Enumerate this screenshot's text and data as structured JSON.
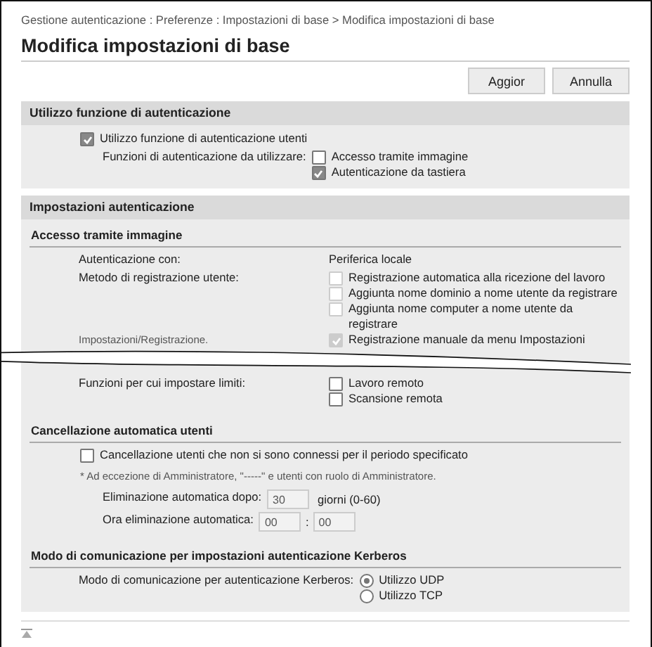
{
  "breadcrumb": "Gestione autenticazione : Preferenze : Impostazioni di base > Modifica impostazioni di base",
  "title": "Modifica impostazioni di base",
  "buttons": [
    {
      "label": "Aggior"
    },
    {
      "label": "Annulla"
    }
  ],
  "sections": [
    {
      "heading": "Utilizzo funzione di autenticazione",
      "subsections": [
        {
          "rows": [
            {
              "kind": "checkbox",
              "label": "Utilizzo funzione di autenticazione utenti",
              "checked": true,
              "disabled": false
            },
            {
              "kind": "options",
              "label": "Funzioni di autenticazione da utilizzare:",
              "options": [
                {
                  "label": "Accesso tramite immagine",
                  "checked": false,
                  "disabled": false
                },
                {
                  "label": "Autenticazione da tastiera",
                  "checked": true,
                  "disabled": false
                }
              ]
            }
          ]
        }
      ]
    },
    {
      "heading": "Impostazioni autenticazione",
      "subsections": [
        {
          "heading": "Accesso tramite immagine",
          "rows": [
            {
              "kind": "text",
              "label": "Autenticazione con:",
              "value": "Periferica locale"
            },
            {
              "kind": "options",
              "label": "Metodo di registrazione utente:",
              "note": "Impostazioni/Registrazione.",
              "break": true,
              "options": [
                {
                  "label": "Registrazione automatica alla ricezione del lavoro",
                  "checked": false,
                  "disabled": true
                },
                {
                  "label": "Aggiunta nome dominio a nome utente da registrare",
                  "checked": false,
                  "disabled": true
                },
                {
                  "label": "Aggiunta nome computer a nome utente da registrare",
                  "checked": false,
                  "disabled": true
                },
                {
                  "label": "Registrazione manuale da menu Impostazioni",
                  "checked": true,
                  "disabled": true
                }
              ]
            },
            {
              "kind": "options",
              "label": "Funzioni per cui impostare limiti:",
              "options": [
                {
                  "label": "Lavoro remoto",
                  "checked": false,
                  "disabled": false
                },
                {
                  "label": "Scansione remota",
                  "checked": false,
                  "disabled": false
                }
              ]
            }
          ]
        },
        {
          "heading": "Cancellazione automatica utenti",
          "rows": [
            {
              "kind": "checkbox",
              "label": "Cancellazione utenti che non si sono connessi per il periodo specificato",
              "checked": false,
              "disabled": false
            },
            {
              "kind": "note",
              "text": "* Ad eccezione di Amministratore, \"-----\" e utenti con ruolo di Amministratore."
            },
            {
              "kind": "number",
              "label": "Eliminazione automatica dopo:",
              "value": "30",
              "unit": "giorni (0-60)"
            },
            {
              "kind": "time",
              "label": "Ora eliminazione automatica:",
              "hours": "00",
              "separator": ":",
              "minutes": "00"
            }
          ]
        },
        {
          "heading": "Modo di comunicazione per impostazioni autenticazione Kerberos",
          "rows": [
            {
              "kind": "radio",
              "label": "Modo di comunicazione per autenticazione Kerberos:",
              "options": [
                {
                  "label": "Utilizzo UDP",
                  "selected": true
                },
                {
                  "label": "Utilizzo TCP",
                  "selected": false
                }
              ]
            }
          ]
        }
      ]
    }
  ]
}
